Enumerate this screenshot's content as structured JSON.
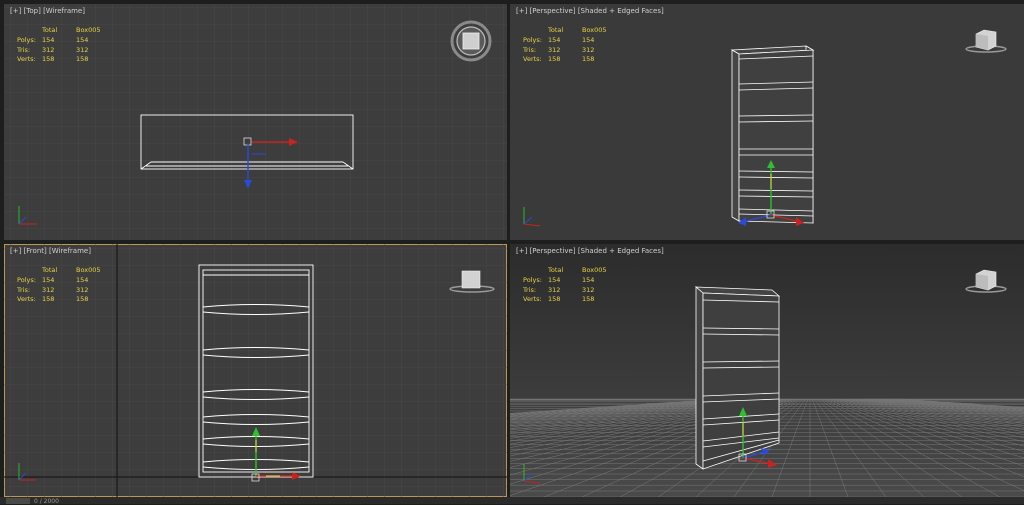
{
  "viewports": {
    "top": {
      "label": {
        "plus": "[+]",
        "view": "[Top]",
        "shading": "[Wireframe]"
      },
      "stats": {
        "header": [
          "",
          "Total",
          "Box005"
        ],
        "rows": [
          [
            "Polys:",
            "154",
            "154"
          ],
          [
            "Tris:",
            "312",
            "312"
          ],
          [
            "Verts:",
            "158",
            "158"
          ]
        ]
      }
    },
    "persp_top": {
      "label": {
        "plus": "[+]",
        "view": "[Perspective]",
        "shading": "[Shaded + Edged Faces]"
      },
      "stats": {
        "header": [
          "",
          "Total",
          "Box005"
        ],
        "rows": [
          [
            "Polys:",
            "154",
            "154"
          ],
          [
            "Tris:",
            "312",
            "312"
          ],
          [
            "Verts:",
            "158",
            "158"
          ]
        ]
      }
    },
    "front": {
      "label": {
        "plus": "[+]",
        "view": "[Front]",
        "shading": "[Wireframe]"
      },
      "stats": {
        "header": [
          "",
          "Total",
          "Box005"
        ],
        "rows": [
          [
            "Polys:",
            "154",
            "154"
          ],
          [
            "Tris:",
            "312",
            "312"
          ],
          [
            "Verts:",
            "158",
            "158"
          ]
        ]
      }
    },
    "persp_bottom": {
      "label": {
        "plus": "[+]",
        "view": "[Perspective]",
        "shading": "[Shaded + Edged Faces]"
      },
      "stats": {
        "header": [
          "",
          "Total",
          "Box005"
        ],
        "rows": [
          [
            "Polys:",
            "154",
            "154"
          ],
          [
            "Tris:",
            "312",
            "312"
          ],
          [
            "Verts:",
            "158",
            "158"
          ]
        ]
      }
    }
  },
  "statusbar": {
    "frame_counter": "0 / 2000"
  },
  "colors": {
    "stats_text": "#e6d348",
    "active_border": "#b89a52",
    "axis_x": "#c8231e",
    "axis_y": "#2fbf2f",
    "axis_z": "#2b4bd6"
  }
}
